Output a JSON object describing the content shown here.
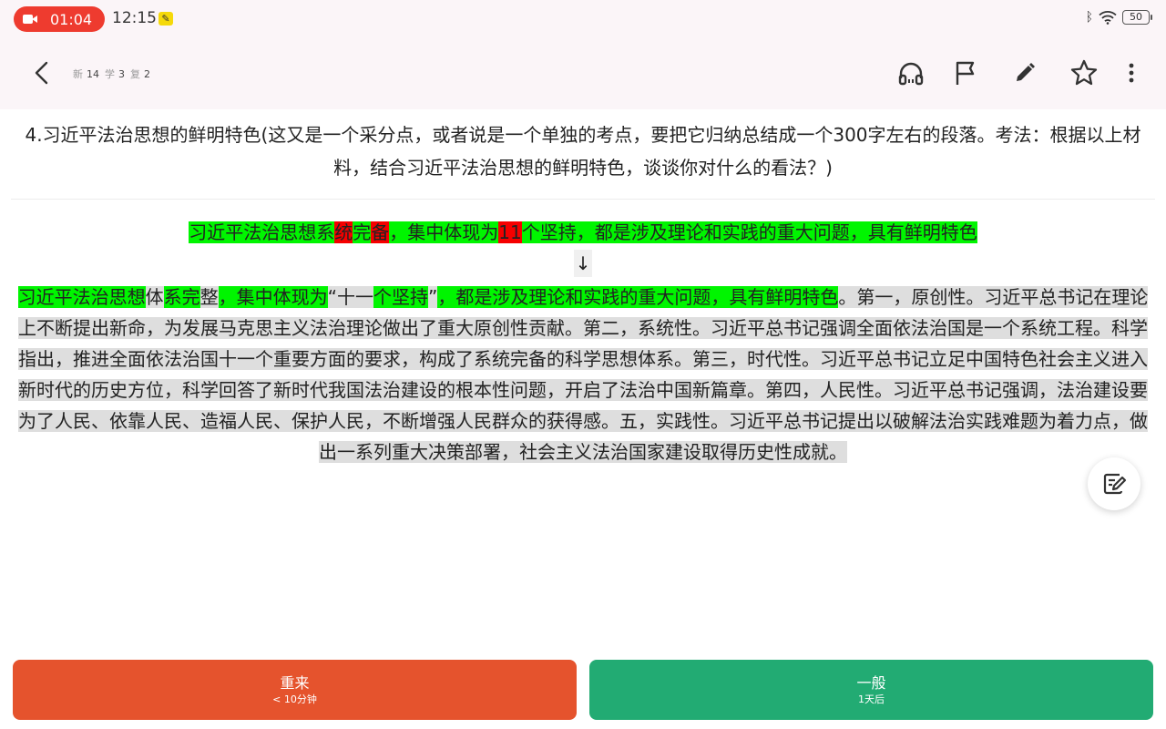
{
  "status_bar": {
    "recording_time": "01:04",
    "clock": "12:15",
    "battery": "50"
  },
  "header": {
    "counts": [
      {
        "label": "新",
        "value": "14"
      },
      {
        "label": "学",
        "value": "3"
      },
      {
        "label": "复",
        "value": "2"
      }
    ],
    "icons": [
      "back-icon",
      "headphones-icon",
      "flag-icon",
      "pencil-icon",
      "star-icon",
      "more-icon"
    ]
  },
  "card": {
    "question": "4.习近平法治思想的鲜明特色(这又是一个采分点，或者说是一个单独的考点，要把它归纳总结成一个300字左右的段落。考法：根据以上材料，结合习近平法治思想的鲜明特色，谈谈你对什么的看法？)",
    "user_answer": {
      "s1": "习近平法治思想系",
      "s2": "统",
      "s3": "完",
      "s4": "备",
      "s5": "，集中体现为",
      "s6": "11",
      "s7": "个坚持，都是涉及理论和实践的重大问题，具有鲜明特色"
    },
    "arrow": "↓",
    "correct_answer": {
      "s1": "习近平法治思想",
      "s2": "体",
      "s3": "系完",
      "s4": "整",
      "s5": "，集中体现为",
      "s6": "“十一",
      "s7": "个坚持",
      "s8": "”",
      "s9": "，都是涉及理论和实践的重大问题，具有鲜明特色",
      "rest": "。第一，原创性。习近平总书记在理论上不断提出新命，为发展马克思主义法治理论做出了重大原创性贡献。第二，系统性。习近平总书记强调全面依法治国是一个系统工程。科学指出，推进全面依法治国十一个重要方面的要求，构成了系统完备的科学思想体系。第三，时代性。习近平总书记立足中国特色社会主义进入新时代的历史方位，科学回答了新时代我国法治建设的根本性问题，开启了法治中国新篇章。第四，人民性。习近平总书记强调，法治建设要为了人民、依靠人民、造福人民、保护人民，不断增强人民群众的获得感。五，实践性。习近平总书记提出以破解法治实践难题为着力点，做出一系列重大决策部署，社会主义法治国家建设取得历史性成就。"
    }
  },
  "buttons": {
    "again": {
      "label": "重来",
      "sub": "< 10分钟",
      "color": "#e5532d"
    },
    "good": {
      "label": "一般",
      "sub": "1天后",
      "color": "#22ab73"
    }
  }
}
